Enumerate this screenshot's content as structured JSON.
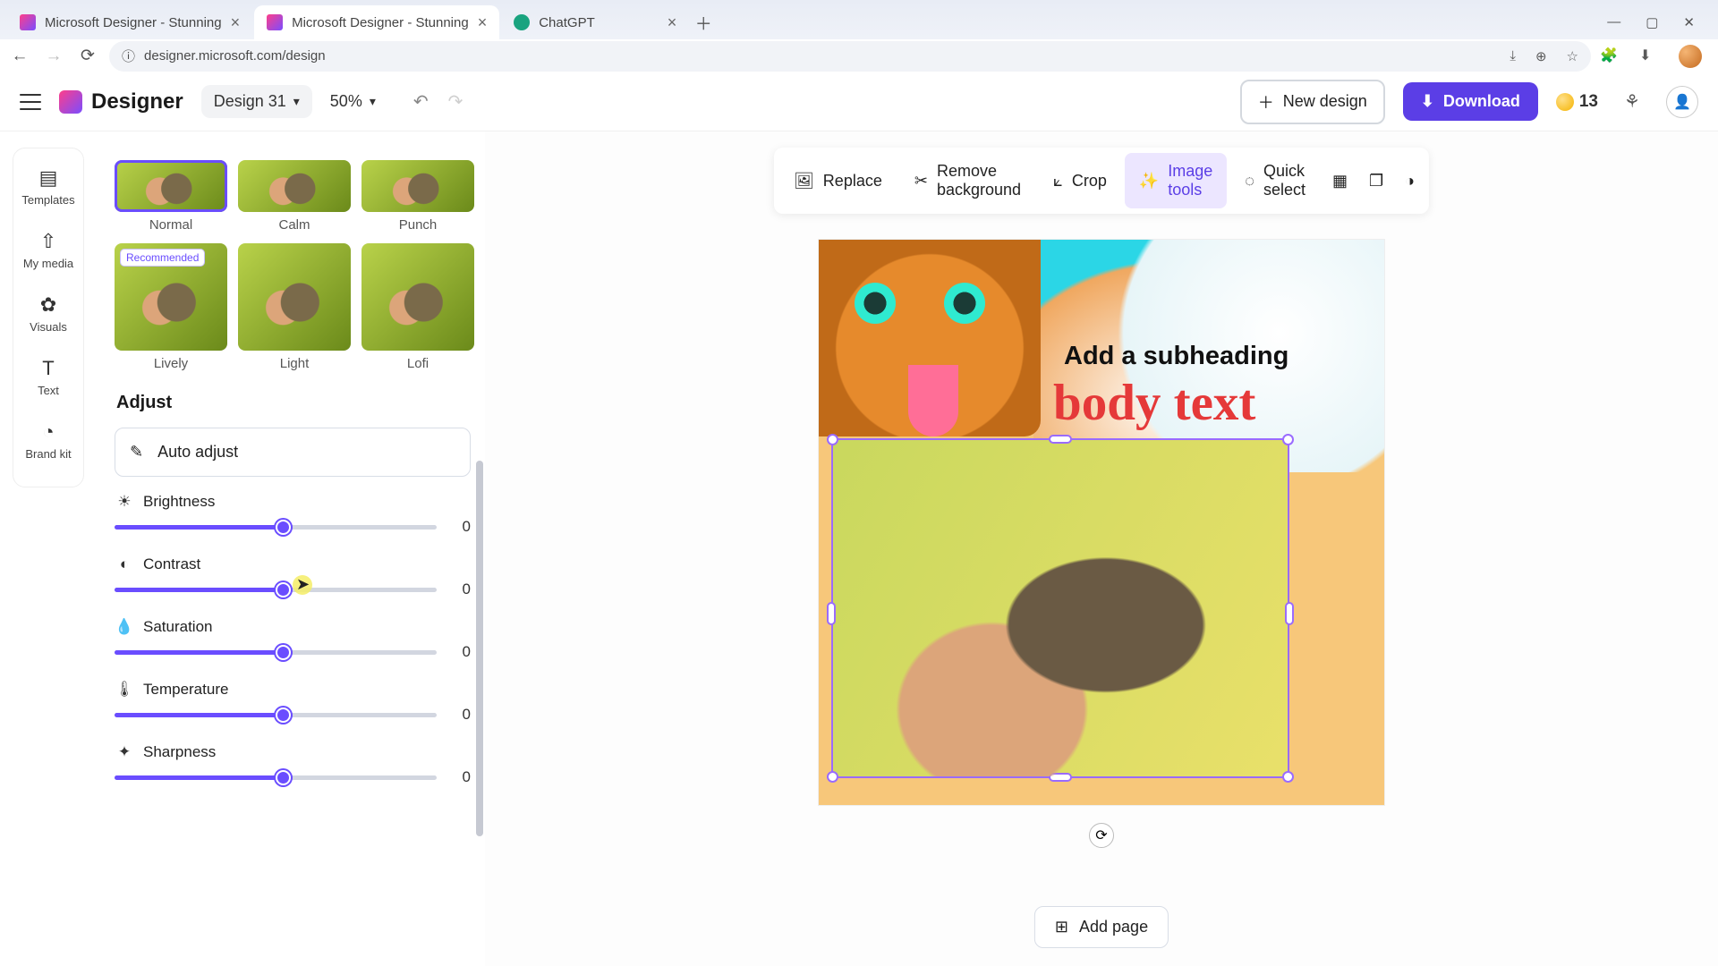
{
  "browser": {
    "tabs": [
      {
        "title": "Microsoft Designer - Stunning",
        "active": false
      },
      {
        "title": "Microsoft Designer - Stunning",
        "active": true
      },
      {
        "title": "ChatGPT",
        "active": false
      }
    ],
    "url": "designer.microsoft.com/design"
  },
  "topbar": {
    "logo_text": "Designer",
    "design_name": "Design 31",
    "zoom": "50%",
    "new_design": "New design",
    "download": "Download",
    "credits": "13"
  },
  "side_tools": [
    {
      "label": "Templates",
      "icon": "▤"
    },
    {
      "label": "My media",
      "icon": "⇧"
    },
    {
      "label": "Visuals",
      "icon": "✿"
    },
    {
      "label": "Text",
      "icon": "T"
    },
    {
      "label": "Brand kit",
      "icon": "◔"
    }
  ],
  "presets": {
    "row1": [
      {
        "label": "Normal",
        "selected": true
      },
      {
        "label": "Calm"
      },
      {
        "label": "Punch"
      }
    ],
    "row2": [
      {
        "label": "Lively",
        "recommended": true
      },
      {
        "label": "Light"
      },
      {
        "label": "Lofi"
      }
    ],
    "recommended_badge": "Recommended"
  },
  "adjust": {
    "heading": "Adjust",
    "auto": "Auto adjust",
    "sliders": [
      {
        "label": "Brightness",
        "value": "0",
        "icon": "☀"
      },
      {
        "label": "Contrast",
        "value": "0",
        "icon": "◐"
      },
      {
        "label": "Saturation",
        "value": "0",
        "icon": "💧"
      },
      {
        "label": "Temperature",
        "value": "0",
        "icon": "🌡"
      },
      {
        "label": "Sharpness",
        "value": "0",
        "icon": "✦"
      }
    ]
  },
  "ctx_toolbar": [
    {
      "label": "Replace",
      "icon": "🖼"
    },
    {
      "label": "Remove background",
      "icon": "✂"
    },
    {
      "label": "Crop",
      "icon": "⟀"
    },
    {
      "label": "Image tools",
      "icon": "✨",
      "active": true
    },
    {
      "label": "Quick select",
      "icon": "◌"
    }
  ],
  "canvas": {
    "subheading": "Add a subheading",
    "body": "body text"
  },
  "add_page": "Add page"
}
